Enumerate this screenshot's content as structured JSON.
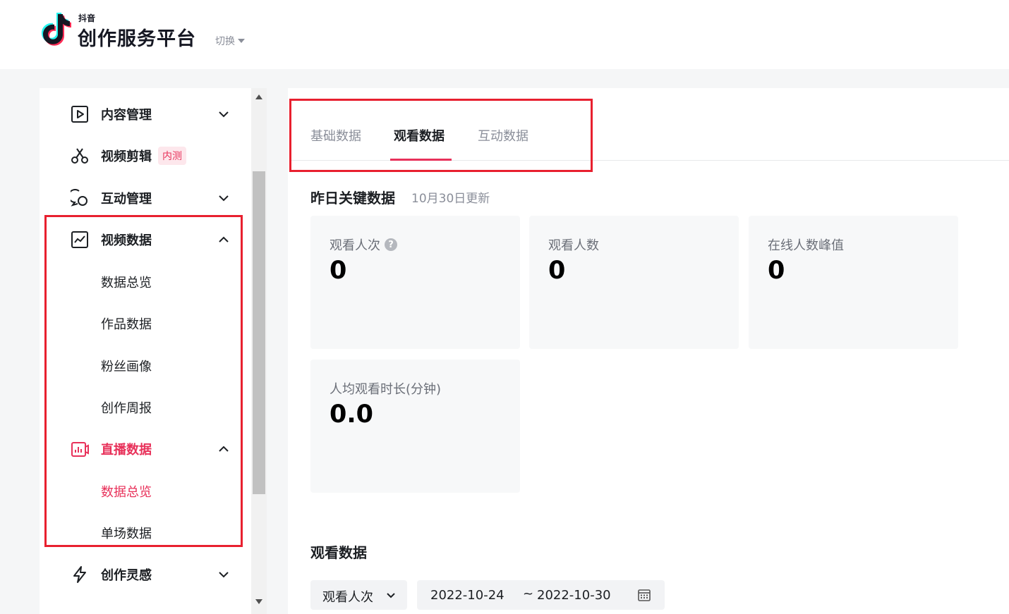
{
  "header": {
    "logo_small": "抖音",
    "logo_title": "创作服务平台",
    "switch_label": "切换"
  },
  "sidebar": {
    "items": [
      {
        "label": "内容管理",
        "icon": "play-square-icon",
        "expanded": false
      },
      {
        "label": "视频剪辑",
        "icon": "scissors-icon",
        "badge": "内测"
      },
      {
        "label": "互动管理",
        "icon": "chat-bubble-icon",
        "expanded": false
      },
      {
        "label": "视频数据",
        "icon": "trend-chart-icon",
        "expanded": true,
        "children": [
          "数据总览",
          "作品数据",
          "粉丝画像",
          "创作周报"
        ]
      },
      {
        "label": "直播数据",
        "icon": "live-chart-icon",
        "expanded": true,
        "active": true,
        "children": [
          "数据总览",
          "单场数据"
        ],
        "active_child": 0
      },
      {
        "label": "创作灵感",
        "icon": "lightning-icon",
        "expanded": false
      }
    ]
  },
  "tabs": [
    {
      "label": "基础数据",
      "active": false
    },
    {
      "label": "观看数据",
      "active": true
    },
    {
      "label": "互动数据",
      "active": false
    }
  ],
  "key_data": {
    "title": "昨日关键数据",
    "updated": "10月30日更新",
    "cards": [
      {
        "label": "观看人次",
        "value": "0",
        "help": "?"
      },
      {
        "label": "观看人数",
        "value": "0"
      },
      {
        "label": "在线人数峰值",
        "value": "0"
      },
      {
        "label": "人均观看时长(分钟)",
        "value": "0.0"
      }
    ]
  },
  "watch_section": {
    "title": "观看数据",
    "metric_select": "观看人次",
    "date_start": "2022-10-24",
    "date_sep": "~",
    "date_end": "2022-10-30"
  },
  "colors": {
    "accent": "#e8315a",
    "highlight": "#e8202f"
  }
}
